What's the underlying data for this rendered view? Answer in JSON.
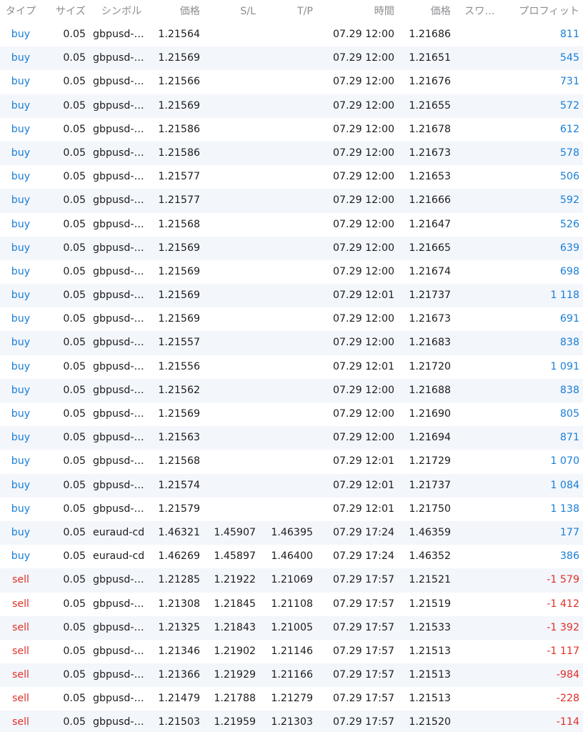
{
  "colors": {
    "buy": "#1a7fd6",
    "sell": "#e0302a",
    "header_text": "#8e8e93",
    "row_alt_bg": "#f3f6fb"
  },
  "header": {
    "type": "タイプ",
    "size": "サイズ",
    "symbol": "シンボル",
    "price": "価格",
    "sl": "S/L",
    "tp": "T/P",
    "time": "時間",
    "current_price": "価格",
    "swap": "スワ…",
    "profit": "プロフィット"
  },
  "rows": [
    {
      "type": "buy",
      "size": "0.05",
      "symbol": "gbpusd-…",
      "price": "1.21564",
      "sl": "",
      "tp": "",
      "time": "07.29 12:00",
      "current_price": "1.21686",
      "swap": "",
      "profit": "811"
    },
    {
      "type": "buy",
      "size": "0.05",
      "symbol": "gbpusd-…",
      "price": "1.21569",
      "sl": "",
      "tp": "",
      "time": "07.29 12:00",
      "current_price": "1.21651",
      "swap": "",
      "profit": "545"
    },
    {
      "type": "buy",
      "size": "0.05",
      "symbol": "gbpusd-…",
      "price": "1.21566",
      "sl": "",
      "tp": "",
      "time": "07.29 12:00",
      "current_price": "1.21676",
      "swap": "",
      "profit": "731"
    },
    {
      "type": "buy",
      "size": "0.05",
      "symbol": "gbpusd-…",
      "price": "1.21569",
      "sl": "",
      "tp": "",
      "time": "07.29 12:00",
      "current_price": "1.21655",
      "swap": "",
      "profit": "572"
    },
    {
      "type": "buy",
      "size": "0.05",
      "symbol": "gbpusd-…",
      "price": "1.21586",
      "sl": "",
      "tp": "",
      "time": "07.29 12:00",
      "current_price": "1.21678",
      "swap": "",
      "profit": "612"
    },
    {
      "type": "buy",
      "size": "0.05",
      "symbol": "gbpusd-…",
      "price": "1.21586",
      "sl": "",
      "tp": "",
      "time": "07.29 12:00",
      "current_price": "1.21673",
      "swap": "",
      "profit": "578"
    },
    {
      "type": "buy",
      "size": "0.05",
      "symbol": "gbpusd-…",
      "price": "1.21577",
      "sl": "",
      "tp": "",
      "time": "07.29 12:00",
      "current_price": "1.21653",
      "swap": "",
      "profit": "506"
    },
    {
      "type": "buy",
      "size": "0.05",
      "symbol": "gbpusd-…",
      "price": "1.21577",
      "sl": "",
      "tp": "",
      "time": "07.29 12:00",
      "current_price": "1.21666",
      "swap": "",
      "profit": "592"
    },
    {
      "type": "buy",
      "size": "0.05",
      "symbol": "gbpusd-…",
      "price": "1.21568",
      "sl": "",
      "tp": "",
      "time": "07.29 12:00",
      "current_price": "1.21647",
      "swap": "",
      "profit": "526"
    },
    {
      "type": "buy",
      "size": "0.05",
      "symbol": "gbpusd-…",
      "price": "1.21569",
      "sl": "",
      "tp": "",
      "time": "07.29 12:00",
      "current_price": "1.21665",
      "swap": "",
      "profit": "639"
    },
    {
      "type": "buy",
      "size": "0.05",
      "symbol": "gbpusd-…",
      "price": "1.21569",
      "sl": "",
      "tp": "",
      "time": "07.29 12:00",
      "current_price": "1.21674",
      "swap": "",
      "profit": "698"
    },
    {
      "type": "buy",
      "size": "0.05",
      "symbol": "gbpusd-…",
      "price": "1.21569",
      "sl": "",
      "tp": "",
      "time": "07.29 12:01",
      "current_price": "1.21737",
      "swap": "",
      "profit": "1 118"
    },
    {
      "type": "buy",
      "size": "0.05",
      "symbol": "gbpusd-…",
      "price": "1.21569",
      "sl": "",
      "tp": "",
      "time": "07.29 12:00",
      "current_price": "1.21673",
      "swap": "",
      "profit": "691"
    },
    {
      "type": "buy",
      "size": "0.05",
      "symbol": "gbpusd-…",
      "price": "1.21557",
      "sl": "",
      "tp": "",
      "time": "07.29 12:00",
      "current_price": "1.21683",
      "swap": "",
      "profit": "838"
    },
    {
      "type": "buy",
      "size": "0.05",
      "symbol": "gbpusd-…",
      "price": "1.21556",
      "sl": "",
      "tp": "",
      "time": "07.29 12:01",
      "current_price": "1.21720",
      "swap": "",
      "profit": "1 091"
    },
    {
      "type": "buy",
      "size": "0.05",
      "symbol": "gbpusd-…",
      "price": "1.21562",
      "sl": "",
      "tp": "",
      "time": "07.29 12:00",
      "current_price": "1.21688",
      "swap": "",
      "profit": "838"
    },
    {
      "type": "buy",
      "size": "0.05",
      "symbol": "gbpusd-…",
      "price": "1.21569",
      "sl": "",
      "tp": "",
      "time": "07.29 12:00",
      "current_price": "1.21690",
      "swap": "",
      "profit": "805"
    },
    {
      "type": "buy",
      "size": "0.05",
      "symbol": "gbpusd-…",
      "price": "1.21563",
      "sl": "",
      "tp": "",
      "time": "07.29 12:00",
      "current_price": "1.21694",
      "swap": "",
      "profit": "871"
    },
    {
      "type": "buy",
      "size": "0.05",
      "symbol": "gbpusd-…",
      "price": "1.21568",
      "sl": "",
      "tp": "",
      "time": "07.29 12:01",
      "current_price": "1.21729",
      "swap": "",
      "profit": "1 070"
    },
    {
      "type": "buy",
      "size": "0.05",
      "symbol": "gbpusd-…",
      "price": "1.21574",
      "sl": "",
      "tp": "",
      "time": "07.29 12:01",
      "current_price": "1.21737",
      "swap": "",
      "profit": "1 084"
    },
    {
      "type": "buy",
      "size": "0.05",
      "symbol": "gbpusd-…",
      "price": "1.21579",
      "sl": "",
      "tp": "",
      "time": "07.29 12:01",
      "current_price": "1.21750",
      "swap": "",
      "profit": "1 138"
    },
    {
      "type": "buy",
      "size": "0.05",
      "symbol": "euraud-cd",
      "price": "1.46321",
      "sl": "1.45907",
      "tp": "1.46395",
      "time": "07.29 17:24",
      "current_price": "1.46359",
      "swap": "",
      "profit": "177"
    },
    {
      "type": "buy",
      "size": "0.05",
      "symbol": "euraud-cd",
      "price": "1.46269",
      "sl": "1.45897",
      "tp": "1.46400",
      "time": "07.29 17:24",
      "current_price": "1.46352",
      "swap": "",
      "profit": "386"
    },
    {
      "type": "sell",
      "size": "0.05",
      "symbol": "gbpusd-…",
      "price": "1.21285",
      "sl": "1.21922",
      "tp": "1.21069",
      "time": "07.29 17:57",
      "current_price": "1.21521",
      "swap": "",
      "profit": "-1 579"
    },
    {
      "type": "sell",
      "size": "0.05",
      "symbol": "gbpusd-…",
      "price": "1.21308",
      "sl": "1.21845",
      "tp": "1.21108",
      "time": "07.29 17:57",
      "current_price": "1.21519",
      "swap": "",
      "profit": "-1 412"
    },
    {
      "type": "sell",
      "size": "0.05",
      "symbol": "gbpusd-…",
      "price": "1.21325",
      "sl": "1.21843",
      "tp": "1.21005",
      "time": "07.29 17:57",
      "current_price": "1.21533",
      "swap": "",
      "profit": "-1 392"
    },
    {
      "type": "sell",
      "size": "0.05",
      "symbol": "gbpusd-…",
      "price": "1.21346",
      "sl": "1.21902",
      "tp": "1.21146",
      "time": "07.29 17:57",
      "current_price": "1.21513",
      "swap": "",
      "profit": "-1 117"
    },
    {
      "type": "sell",
      "size": "0.05",
      "symbol": "gbpusd-…",
      "price": "1.21366",
      "sl": "1.21929",
      "tp": "1.21166",
      "time": "07.29 17:57",
      "current_price": "1.21513",
      "swap": "",
      "profit": "-984"
    },
    {
      "type": "sell",
      "size": "0.05",
      "symbol": "gbpusd-…",
      "price": "1.21479",
      "sl": "1.21788",
      "tp": "1.21279",
      "time": "07.29 17:57",
      "current_price": "1.21513",
      "swap": "",
      "profit": "-228"
    },
    {
      "type": "sell",
      "size": "0.05",
      "symbol": "gbpusd-…",
      "price": "1.21503",
      "sl": "1.21959",
      "tp": "1.21303",
      "time": "07.29 17:57",
      "current_price": "1.21520",
      "swap": "",
      "profit": "-114"
    }
  ]
}
